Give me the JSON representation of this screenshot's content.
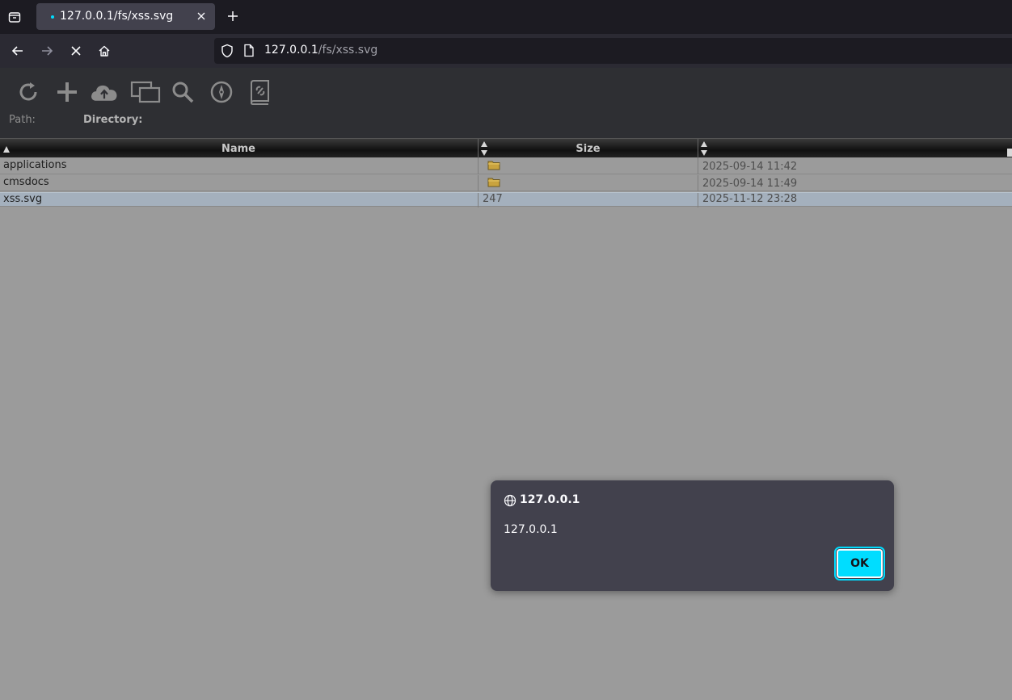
{
  "browser": {
    "tab_title": "127.0.0.1/fs/xss.svg",
    "url_host": "127.0.0.1",
    "url_path": "/fs/xss.svg",
    "accent_color": "#00ddff"
  },
  "filemanager": {
    "path_label": "Path:",
    "directory_label": "Directory:",
    "tools": [
      "refresh-icon",
      "add-icon",
      "upload-cloud-icon",
      "windows-icon",
      "search-icon",
      "compass-icon",
      "link-book-icon"
    ],
    "columns": {
      "name": "Name",
      "size": "Size"
    },
    "rows": [
      {
        "name": "applications",
        "size": "",
        "type": "folder",
        "date": "2025-09-14 11:42"
      },
      {
        "name": "cmsdocs",
        "size": "",
        "type": "folder",
        "date": "2025-09-14 11:49"
      },
      {
        "name": "xss.svg",
        "size": "247",
        "type": "file",
        "date": "2025-11-12 23:28"
      }
    ]
  },
  "alert": {
    "origin": "127.0.0.1",
    "message": "127.0.0.1",
    "ok_label": "OK"
  }
}
